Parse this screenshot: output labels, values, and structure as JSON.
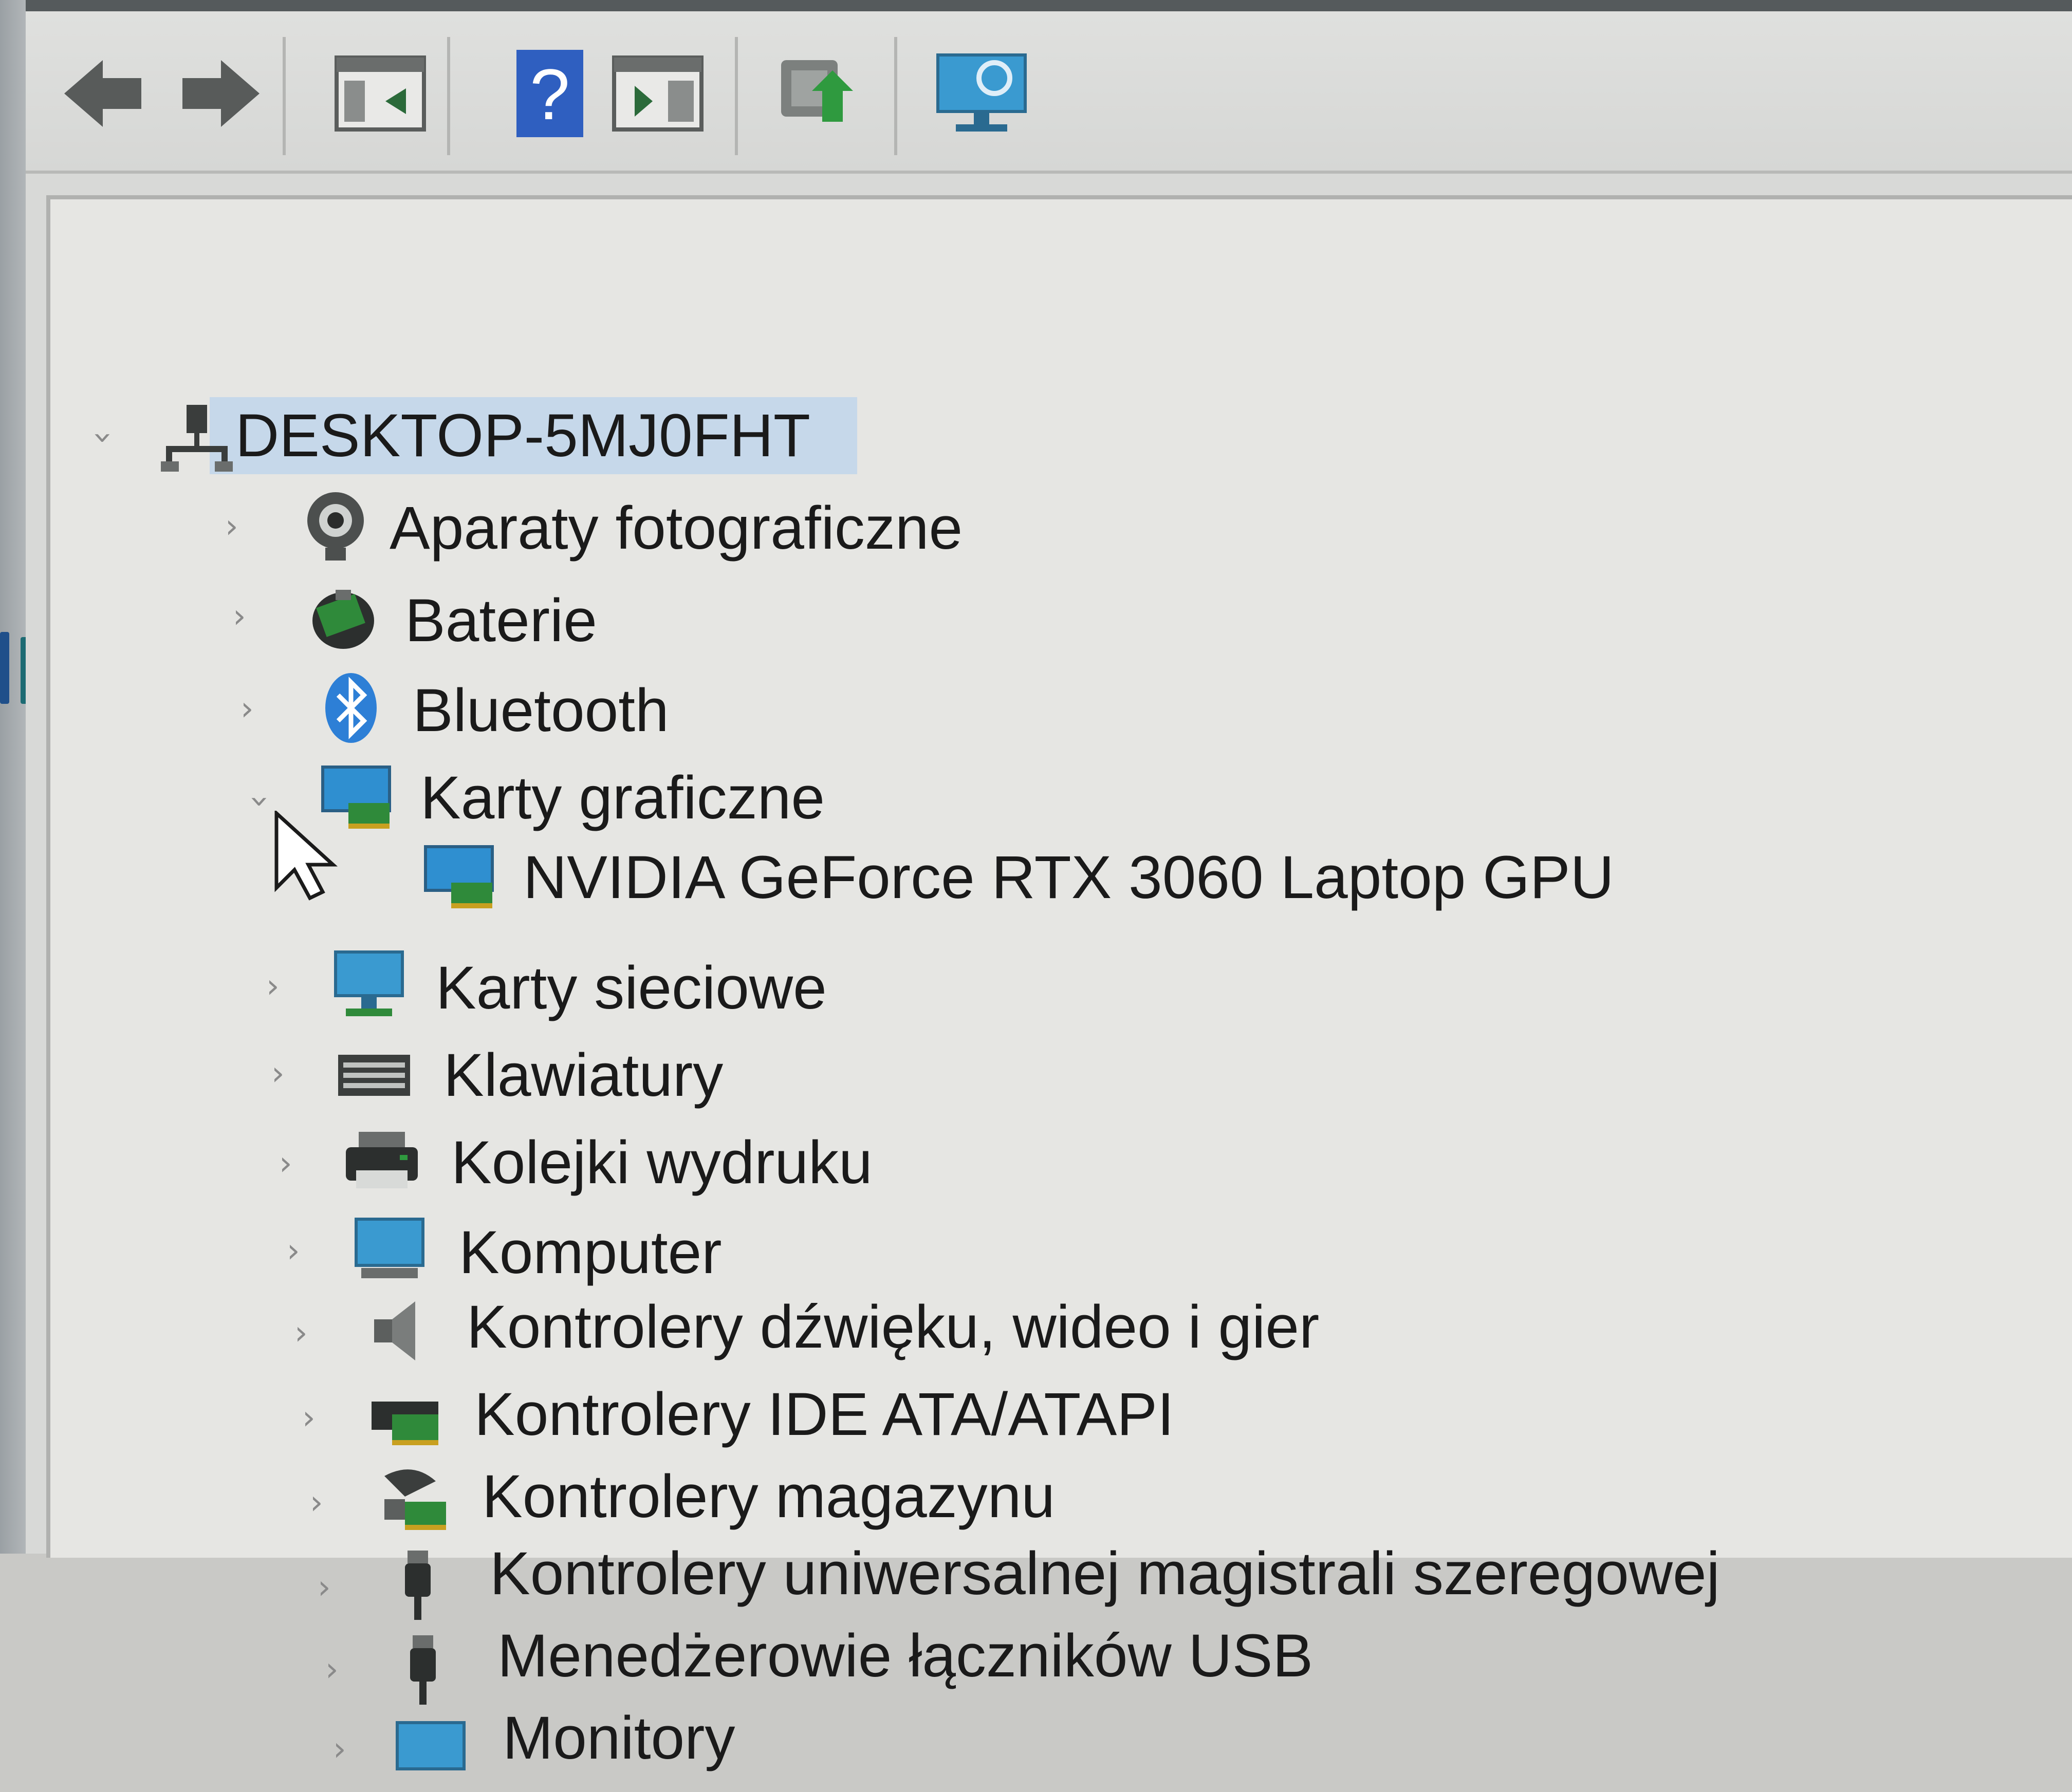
{
  "toolbar": {
    "buttons": [
      {
        "name": "back-button",
        "icon": "arrow-left-icon"
      },
      {
        "name": "forward-button",
        "icon": "arrow-right-icon"
      },
      {
        "name": "show-hide-console-tree-button",
        "icon": "console-tree-icon"
      },
      {
        "name": "help-button",
        "icon": "help-icon",
        "glyph": "?"
      },
      {
        "name": "properties-pane-button",
        "icon": "properties-pane-icon"
      },
      {
        "name": "update-driver-button",
        "icon": "update-driver-icon"
      },
      {
        "name": "scan-hardware-button",
        "icon": "monitor-scan-icon"
      }
    ]
  },
  "tree": {
    "root": {
      "label": "DESKTOP-5MJ0FHT",
      "expanded": true,
      "icon": "computer-network-icon"
    },
    "categories": [
      {
        "label": "Aparaty fotograficzne",
        "icon": "camera-icon",
        "expanded": false
      },
      {
        "label": "Baterie",
        "icon": "battery-icon",
        "expanded": false
      },
      {
        "label": "Bluetooth",
        "icon": "bluetooth-icon",
        "expanded": false
      },
      {
        "label": "Karty graficzne",
        "icon": "display-adapter-icon",
        "expanded": true,
        "children": [
          {
            "label": "NVIDIA GeForce RTX 3060 Laptop GPU",
            "icon": "display-adapter-icon"
          }
        ]
      },
      {
        "label": "Karty sieciowe",
        "icon": "network-adapter-icon",
        "expanded": false
      },
      {
        "label": "Klawiatury",
        "icon": "keyboard-icon",
        "expanded": false
      },
      {
        "label": "Kolejki wydruku",
        "icon": "printer-icon",
        "expanded": false
      },
      {
        "label": "Komputer",
        "icon": "monitor-icon",
        "expanded": false
      },
      {
        "label": "Kontrolery dźwięku, wideo i gier",
        "icon": "speaker-icon",
        "expanded": false
      },
      {
        "label": "Kontrolery IDE ATA/ATAPI",
        "icon": "ide-controller-icon",
        "expanded": false
      },
      {
        "label": "Kontrolery magazynu",
        "icon": "storage-controller-icon",
        "expanded": false
      },
      {
        "label": "Kontrolery uniwersalnej magistrali szeregowej",
        "icon": "usb-controller-icon",
        "expanded": false
      },
      {
        "label": "Menedżerowie łączników USB",
        "icon": "usb-connector-icon",
        "expanded": false
      },
      {
        "label": "Monitory",
        "icon": "monitor-icon",
        "expanded": false
      }
    ]
  },
  "colors": {
    "selection": "#c6d8ea",
    "text": "#1a1a1a",
    "chevron": "#8a8a8a"
  }
}
